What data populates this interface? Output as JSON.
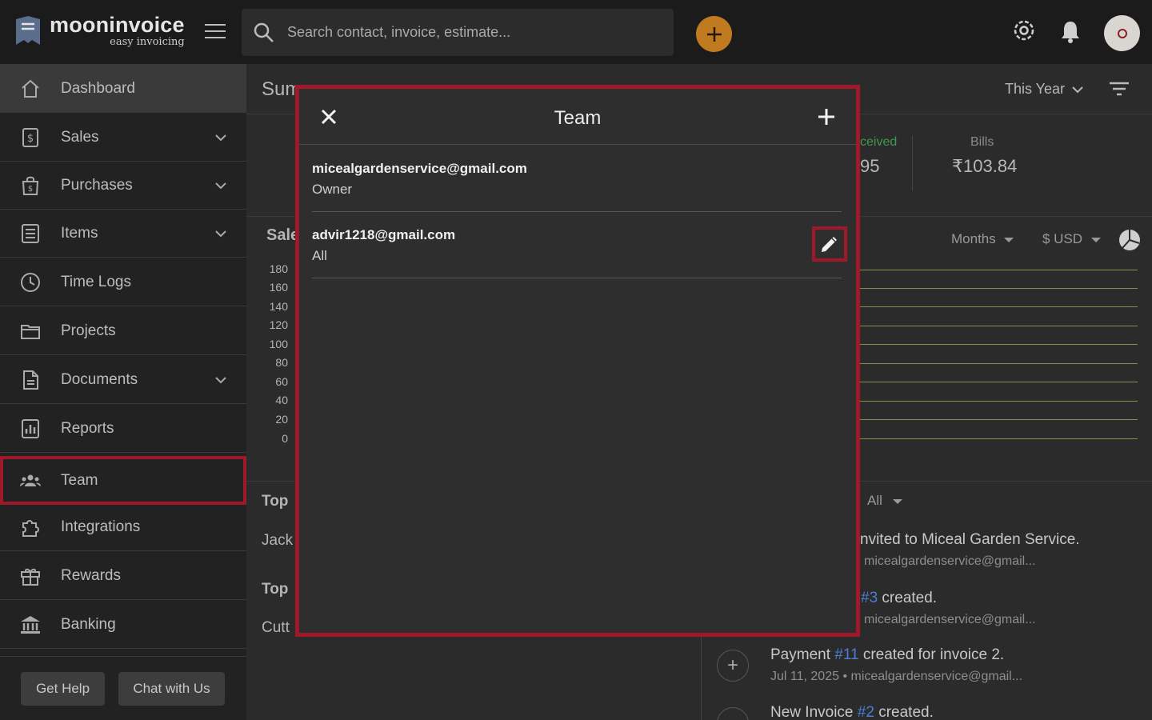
{
  "app": {
    "name": "mooninvoice",
    "tagline": "easy invoicing"
  },
  "search": {
    "placeholder": "Search contact, invoice, estimate..."
  },
  "sidebar": {
    "items": [
      {
        "label": "Dashboard",
        "icon": "home-icon"
      },
      {
        "label": "Sales",
        "icon": "dollar-doc-icon"
      },
      {
        "label": "Purchases",
        "icon": "shopping-bag-icon"
      },
      {
        "label": "Items",
        "icon": "list-icon"
      },
      {
        "label": "Time Logs",
        "icon": "clock-icon"
      },
      {
        "label": "Projects",
        "icon": "folder-icon"
      },
      {
        "label": "Documents",
        "icon": "document-icon"
      },
      {
        "label": "Reports",
        "icon": "bar-chart-icon"
      },
      {
        "label": "Team",
        "icon": "people-icon"
      },
      {
        "label": "Integrations",
        "icon": "puzzle-icon"
      },
      {
        "label": "Rewards",
        "icon": "gift-icon"
      },
      {
        "label": "Banking",
        "icon": "bank-icon"
      }
    ],
    "get_help": "Get Help",
    "chat": "Chat with Us"
  },
  "main": {
    "title": "Sum",
    "period": "This Year",
    "stats": {
      "received_label": "ceived",
      "received_value": "95",
      "bills_label": "Bills",
      "bills_value": "₹103.84"
    },
    "sales_title": "Sale",
    "months": "Months",
    "currency": "$ USD",
    "y_ticks": [
      "180",
      "160",
      "140",
      "120",
      "100",
      "80",
      "60",
      "40",
      "20",
      "0"
    ],
    "top1_title": "Top",
    "top1_item": "Jack",
    "top2_title": "Top",
    "top2_item": "Cutt",
    "activity_filter": "All",
    "activities": [
      {
        "pre": "",
        "link": "",
        "post": "nvited to Miceal Garden Service.",
        "meta": "micealgardenservice@gmail..."
      },
      {
        "pre": "",
        "link": "#3",
        "post": " created.",
        "meta": "micealgardenservice@gmail..."
      },
      {
        "pre": "Payment ",
        "link": "#11",
        "post": " created for invoice 2.",
        "meta": "Jul 11, 2025 • micealgardenservice@gmail..."
      },
      {
        "pre": "New Invoice ",
        "link": "#2",
        "post": " created.",
        "meta": ""
      }
    ]
  },
  "modal": {
    "title": "Team",
    "members": [
      {
        "email": "micealgardenservice@gmail.com",
        "role": "Owner"
      },
      {
        "email": "advir1218@gmail.com",
        "role": "All"
      }
    ]
  },
  "colors": {
    "accent_orange": "#c07a1f",
    "highlight_red": "#a0192a",
    "link_blue": "#4a7fd0"
  }
}
